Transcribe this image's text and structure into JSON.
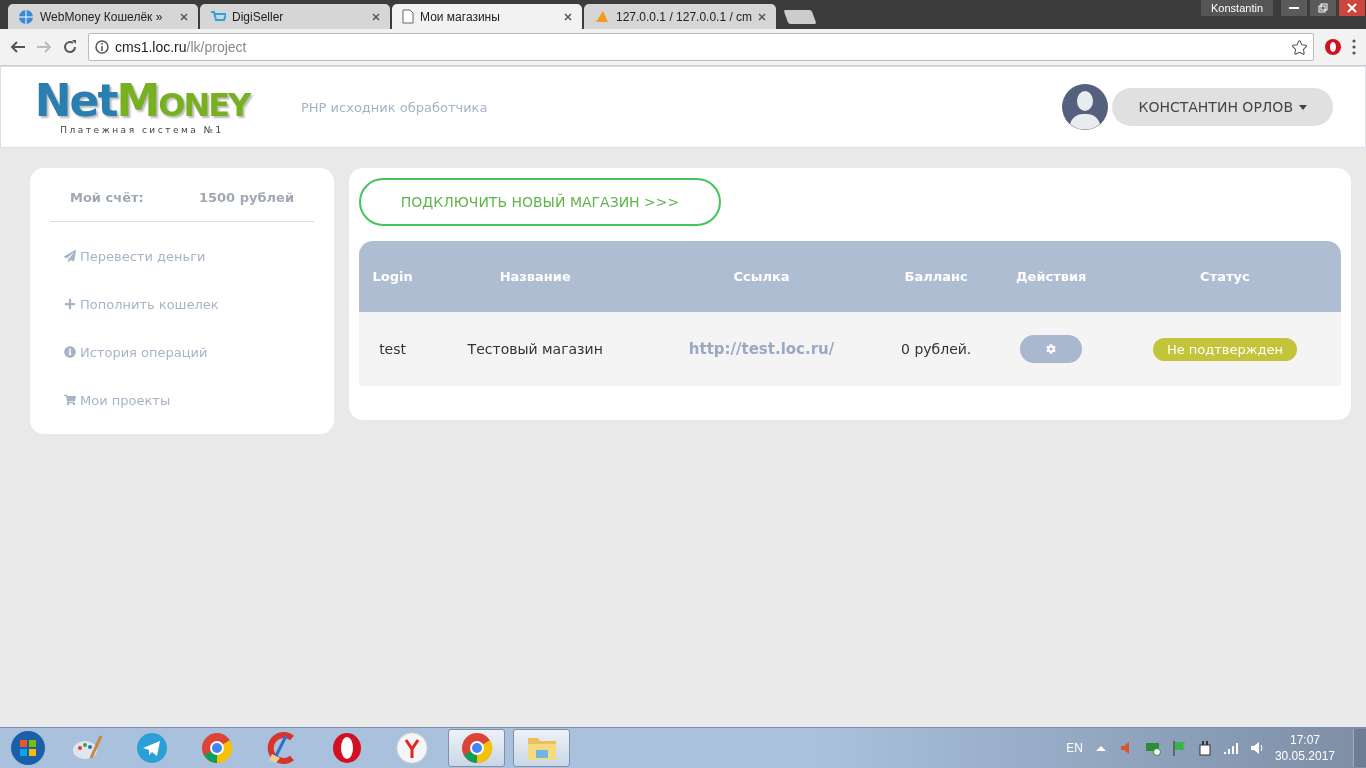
{
  "browser": {
    "tabs": [
      {
        "title": "WebMoney Кошелёк »",
        "kind": "globe",
        "selected": false
      },
      {
        "title": "DigiSeller",
        "kind": "cart",
        "selected": false
      },
      {
        "title": "Мои магазины",
        "kind": "page",
        "selected": true
      },
      {
        "title": "127.0.0.1 / 127.0.0.1 / cm",
        "kind": "pma",
        "selected": false
      }
    ],
    "profile": "Konstantin",
    "address": {
      "host": "cms1.loc.ru",
      "path": "/lk/project"
    }
  },
  "header": {
    "logo": {
      "first": "Net",
      "second": "MONEY",
      "tagline": "Платежная система №1"
    },
    "subtitle": "PHP исходник обработчика",
    "user": {
      "name": "КОНСТАНТИН ОРЛОВ"
    }
  },
  "sidebar": {
    "account": {
      "label": "Мой счёт:",
      "value": "1500 рублей"
    },
    "menu": [
      {
        "label": "Перевести деньги",
        "kind": "send"
      },
      {
        "label": "Пополнить кошелек",
        "kind": "plus"
      },
      {
        "label": "История операций",
        "kind": "info"
      },
      {
        "label": "Мои проекты",
        "kind": "cart"
      }
    ]
  },
  "main": {
    "connect_button": "ПОДКЛЮЧИТЬ НОВЫЙ МАГАЗИН >>>",
    "table": {
      "columns": [
        "Login",
        "Название",
        "Ссылка",
        "Балланс",
        "Действия",
        "Статус"
      ],
      "rows": [
        {
          "login": "test",
          "name": "Тестовый магазин",
          "link": "http://test.loc.ru/",
          "balance": "0 рублей.",
          "status": "Не подтвержден"
        }
      ]
    }
  },
  "taskbar": {
    "apps": [
      {
        "kind": "paint",
        "active": false
      },
      {
        "kind": "telegram",
        "active": false
      },
      {
        "kind": "chrome",
        "active": false
      },
      {
        "kind": "ccleaner",
        "active": false
      },
      {
        "kind": "opera",
        "active": false
      },
      {
        "kind": "yandex",
        "active": false
      },
      {
        "kind": "chrome",
        "active": true
      },
      {
        "kind": "folder",
        "active": true
      }
    ],
    "language": "EN",
    "time": "17:07",
    "date": "30.05.2017"
  }
}
